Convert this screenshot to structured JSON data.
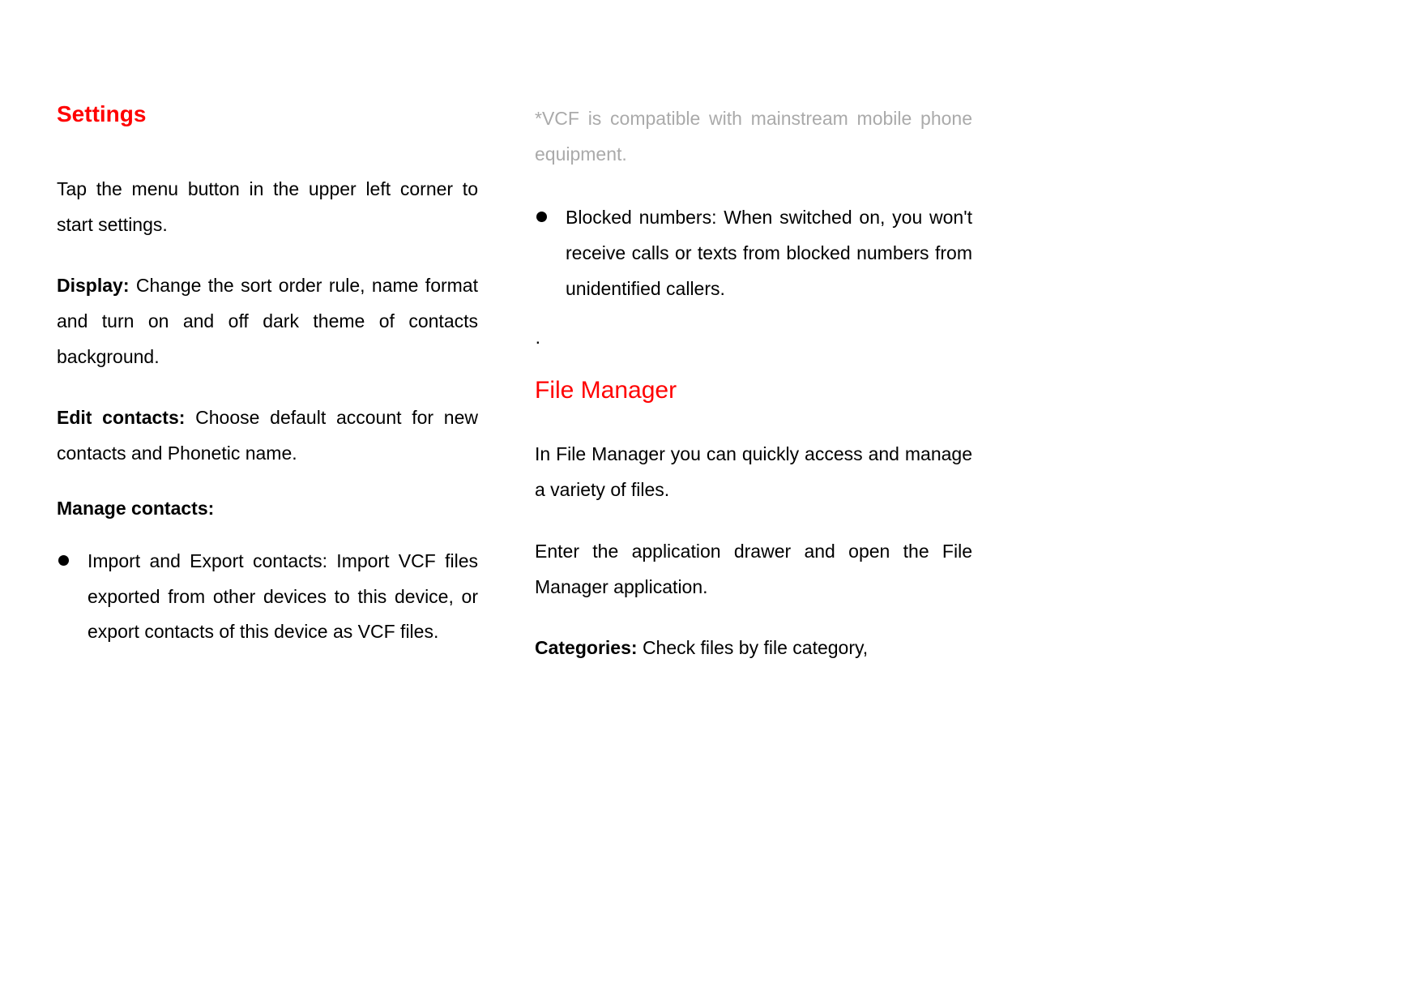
{
  "left": {
    "heading_settings": "Settings",
    "intro": "Tap the menu button in the upper left corner to start settings.",
    "display_label": "Display: ",
    "display_text": "Change the sort order rule, name format and turn on and off dark theme of contacts background.",
    "edit_label": "Edit contacts: ",
    "edit_text": "Choose default account for new contacts and Phonetic name.",
    "manage_heading": "Manage contacts:",
    "bullet_import": "Import and Export contacts: Import VCF files exported from other devices to this device, or export contacts of this device as VCF files."
  },
  "right": {
    "vcf_note": "*VCF is compatible with mainstream mobile phone equipment.",
    "bullet_blocked": "Blocked numbers: When switched on, you won't receive calls or texts from blocked numbers from unidentified callers.",
    "dot": "·",
    "heading_file_manager": "File Manager",
    "fm_intro": "In File Manager you can quickly access and manage a variety of files.",
    "fm_enter": "Enter the application drawer and open the File Manager application.",
    "categories_label": "Categories: ",
    "categories_text": "Check files by file category,"
  }
}
